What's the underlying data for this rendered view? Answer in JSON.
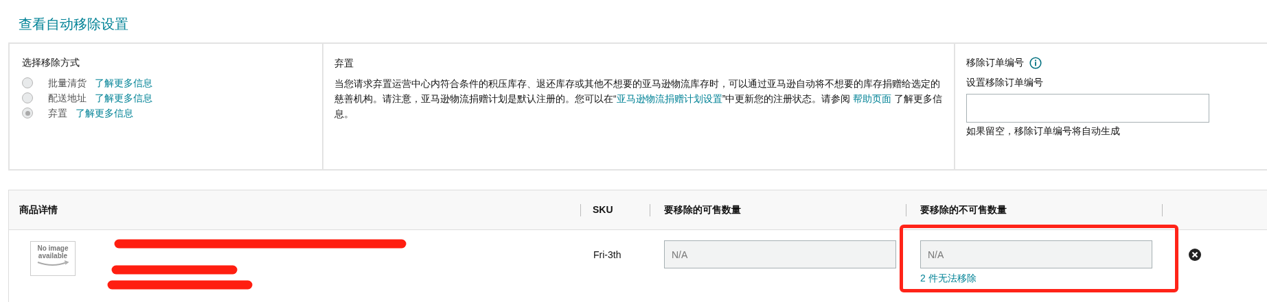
{
  "page_title": "查看自动移除设置",
  "removal_method": {
    "label": "选择移除方式",
    "options": [
      {
        "label": "批量清货",
        "link": "了解更多信息",
        "selected": false
      },
      {
        "label": "配送地址",
        "link": "了解更多信息",
        "selected": false
      },
      {
        "label": "弃置",
        "link": "了解更多信息",
        "selected": true
      }
    ]
  },
  "description": {
    "title": "弃置",
    "parts": [
      {
        "kind": "text",
        "text": "当您请求弃置运营中心内符合条件的积压库存、退还库存或其他不想要的亚马逊物流库存时，可以通过亚马逊自动将不想要的库存捐赠给选定的慈善机构。请注意，亚马逊物流捐赠计划是默认注册的。您可以在“"
      },
      {
        "kind": "link",
        "text": "亚马逊物流捐赠计划设置"
      },
      {
        "kind": "text",
        "text": "”中更新您的注册状态。请参阅 "
      },
      {
        "kind": "link",
        "text": "帮助页面"
      },
      {
        "kind": "text",
        "text": " 了解更多信息。"
      }
    ]
  },
  "order_id": {
    "title": "移除订单编号",
    "label": "设置移除订单编号",
    "hint": "如果留空，移除订单编号将自动生成"
  },
  "table": {
    "columns": [
      "商品详情",
      "SKU",
      "要移除的可售数量",
      "要移除的不可售数量"
    ],
    "rows": [
      {
        "image_text": [
          "No image",
          "available"
        ],
        "sku": "Fri-3th",
        "sellable": {
          "value": "N/A",
          "disabled": true
        },
        "unsellable": {
          "value": "N/A",
          "disabled": true,
          "highlighted": true
        },
        "note": "2 件无法移除"
      }
    ]
  }
}
